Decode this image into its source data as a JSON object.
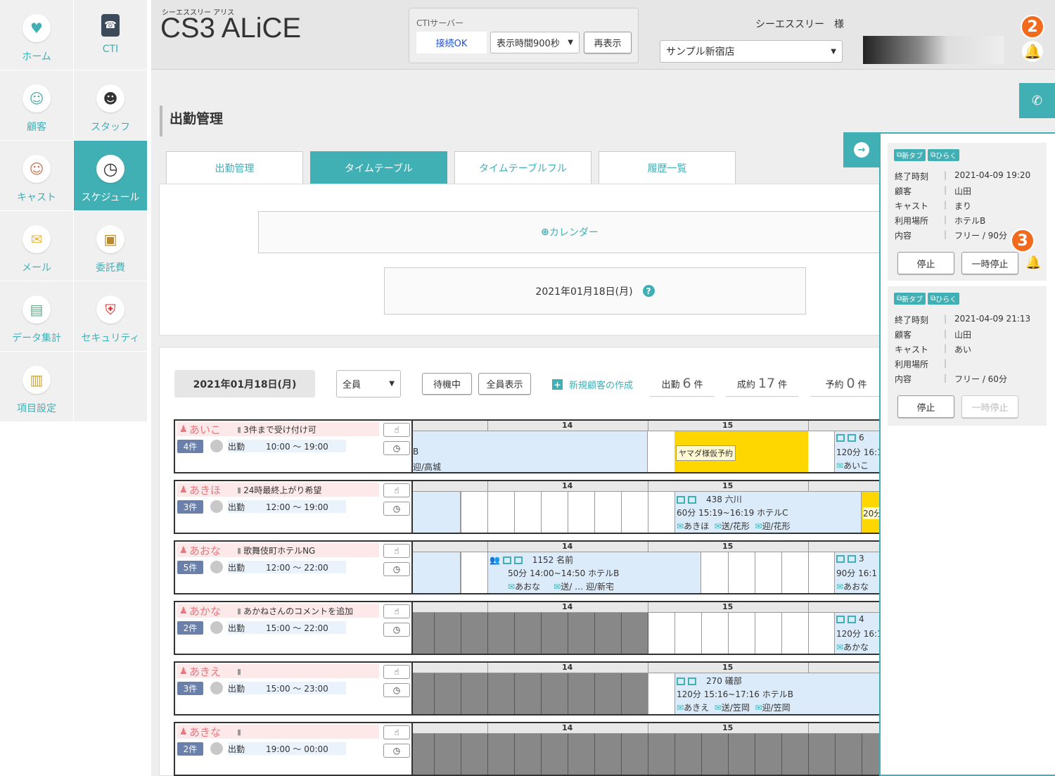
{
  "nav": [
    {
      "label": "ホーム",
      "icon": "bunny-icon"
    },
    {
      "label": "CTI",
      "icon": "phone-icon"
    },
    {
      "label": "顧客",
      "icon": "customer-icon"
    },
    {
      "label": "スタッフ",
      "icon": "staff-icon"
    },
    {
      "label": "キャスト",
      "icon": "cast-icon"
    },
    {
      "label": "スケジュール",
      "icon": "clock-icon"
    },
    {
      "label": "メール",
      "icon": "mail-icon"
    },
    {
      "label": "委託費",
      "icon": "wallet-icon"
    },
    {
      "label": "データ集計",
      "icon": "chart-icon"
    },
    {
      "label": "セキュリティ",
      "icon": "shield-icon"
    },
    {
      "label": "項目設定",
      "icon": "clipboard-icon"
    }
  ],
  "header": {
    "subtitle": "シーエススリー アリス",
    "title": "CS3 ALiCE",
    "cti_label": "CTIサーバー",
    "cti_status": "接続OK",
    "display_time": "表示時間900秒",
    "refresh": "再表示",
    "user": "シーエススリー　様",
    "store": "サンプル新宿店",
    "badge2": "2"
  },
  "page": {
    "title": "出勤管理",
    "tabs": [
      "出勤管理",
      "タイムテーブル",
      "タイムテーブルフル",
      "履歴一覧"
    ],
    "calendar": "カレンダー",
    "date": "2021年01月18日(月)"
  },
  "toolbar": {
    "date": "2021年01月18日(月)",
    "filter": "全員",
    "waiting": "待機中",
    "show_all": "全員表示",
    "new_customer": "新規顧客の作成",
    "attend_label": "出勤",
    "attend_num": "6",
    "attend_unit": "件",
    "contract_label": "成約",
    "contract_num": "17",
    "contract_unit": "件",
    "reserve_label": "予約",
    "reserve_num": "0",
    "reserve_unit": "件"
  },
  "hours": [
    "14",
    "15"
  ],
  "rows": [
    {
      "name": "あいこ",
      "comment": "3件まで受け付け可",
      "count": "4件",
      "status": "出勤",
      "time": "10:00 ～ 19:00"
    },
    {
      "name": "あきほ",
      "comment": "24時最終上がり希望",
      "count": "3件",
      "status": "出勤",
      "time": "12:00 ～ 19:00"
    },
    {
      "name": "あおな",
      "comment": "歌舞伎町ホテルNG",
      "count": "5件",
      "status": "出勤",
      "time": "12:00 ～ 22:00"
    },
    {
      "name": "あかな",
      "comment": "あかねさんのコメントを追加",
      "count": "2件",
      "status": "出勤",
      "time": "15:00 ～ 22:00"
    },
    {
      "name": "あきえ",
      "comment": "",
      "count": "3件",
      "status": "出勤",
      "time": "15:00 ～ 23:00"
    },
    {
      "name": "あきな",
      "comment": "",
      "count": "2件",
      "status": "出勤",
      "time": "19:00 ～ 00:00"
    }
  ],
  "blocks": {
    "r0a": "B",
    "r0b": "迎/高城",
    "r0c": "ヤマダ様仮予約",
    "r0d": "6",
    "r0e": "120分 16:1",
    "r0f": "あいこ",
    "r1a": "438 六川",
    "r1b": "60分 15:19~16:19 ホテルC",
    "r1c": "あきほ",
    "r1d": "送/花形",
    "r1e": "迎/花形",
    "r1f": "20分",
    "r2a": "1152 名前",
    "r2b": "50分 14:00~14:50 ホテルB",
    "r2c": "あおな",
    "r2d": "送/",
    "r2e": "迎/新宅",
    "r2f": "3",
    "r2g": "90分 16:1",
    "r2h": "あおな",
    "r3a": "4",
    "r3b": "120分 16:1",
    "r3c": "あかな",
    "r4a": "270 礒部",
    "r4b": "120分 15:16~17:16 ホテルB",
    "r4c": "あきえ",
    "r4d": "送/笠岡",
    "r4e": "迎/笠岡"
  },
  "panel": {
    "newtab": "新タブ",
    "open": "ひらく",
    "labels": [
      "終了時刻",
      "顧客",
      "キャスト",
      "利用場所",
      "内容"
    ],
    "card1": [
      "2021-04-09 19:20",
      "山田",
      "まり",
      "ホテルB",
      "フリー / 90分"
    ],
    "card2": [
      "2021-04-09 21:13",
      "山田",
      "あい",
      "",
      "フリー / 60分"
    ],
    "stop": "停止",
    "pause": "一時停止",
    "badge3": "3"
  }
}
